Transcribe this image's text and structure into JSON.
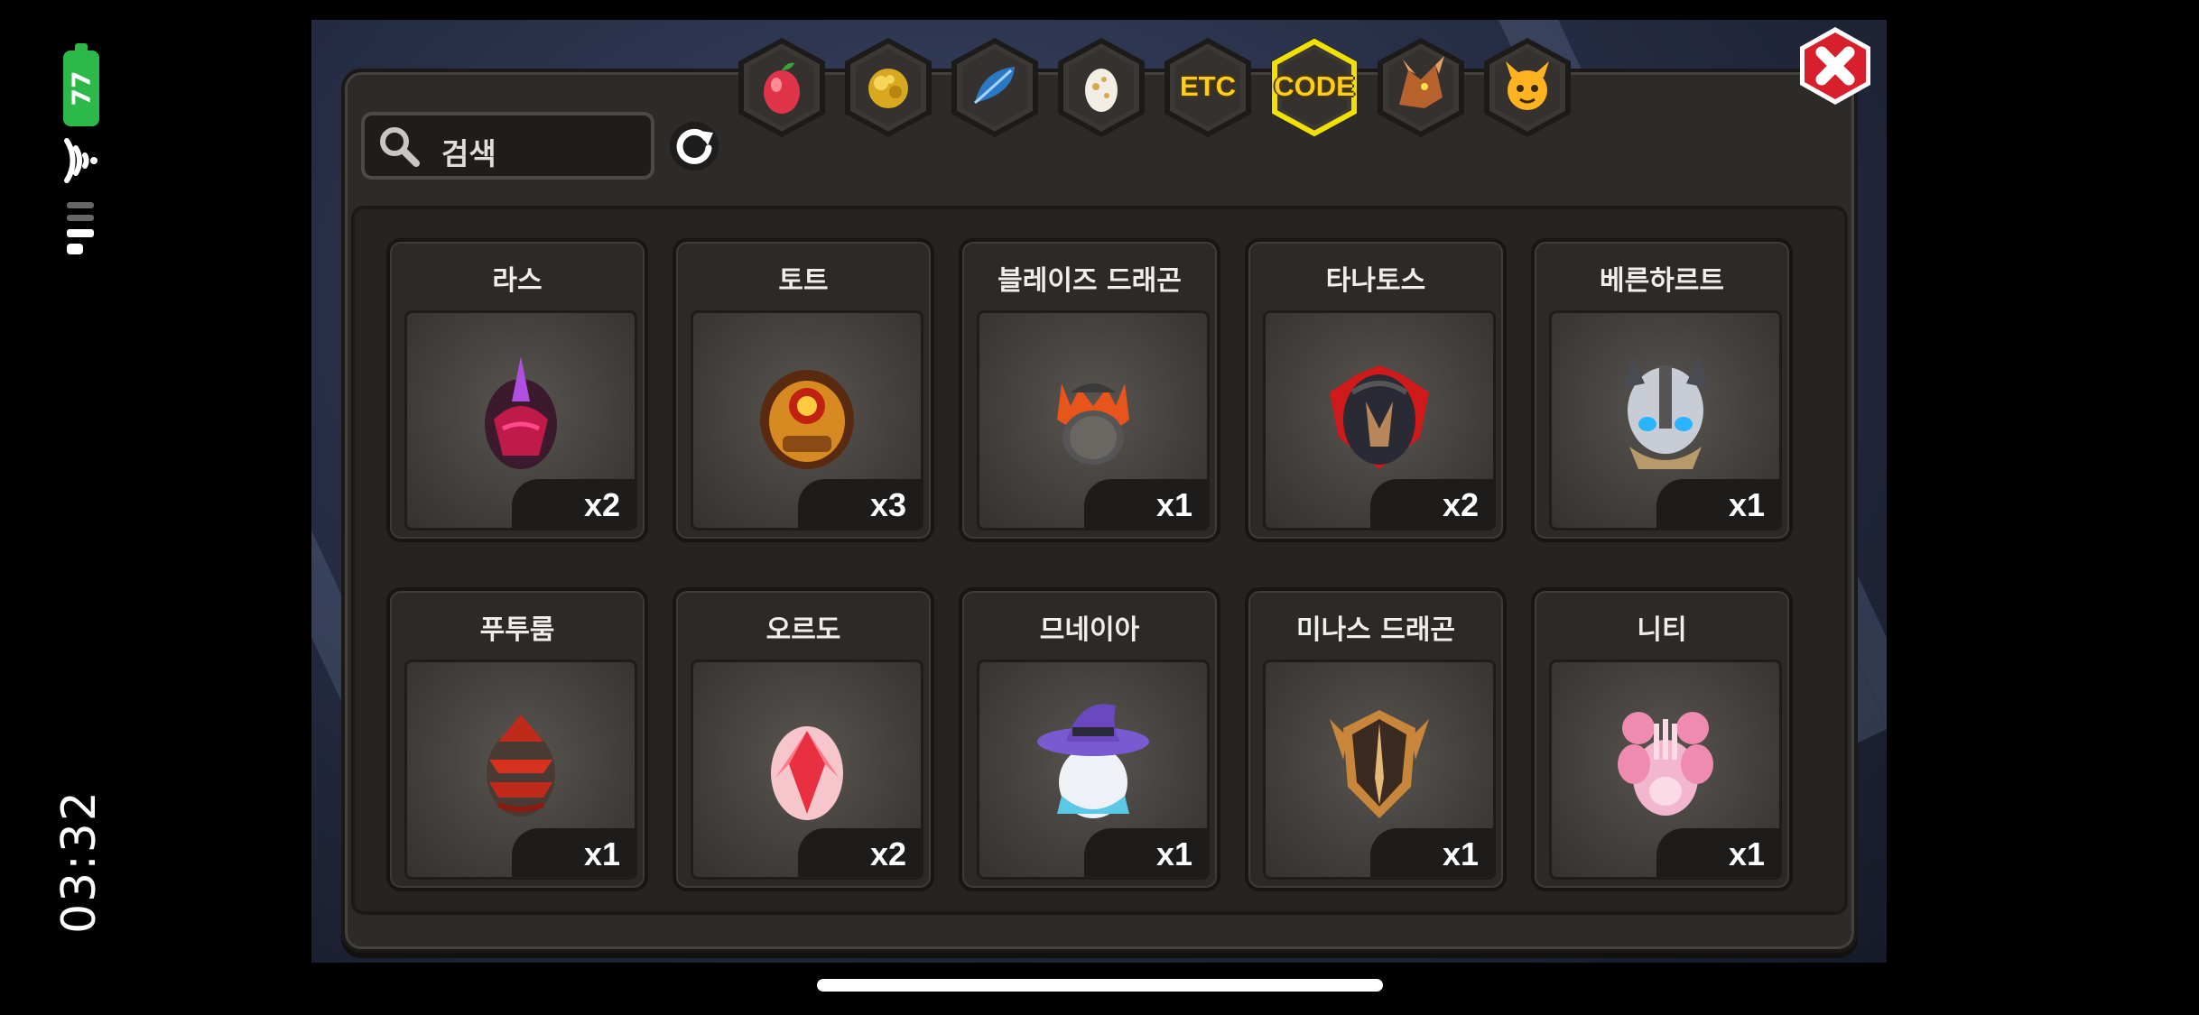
{
  "status": {
    "battery": "77",
    "time": "03:32",
    "colors": {
      "battery": "#2db84a"
    }
  },
  "search": {
    "label": "검색"
  },
  "tabs": [
    {
      "name": "fruit-tab",
      "icon": "red-fruit-icon",
      "text": ""
    },
    {
      "name": "gold-tab",
      "icon": "gold-nugget-icon",
      "text": ""
    },
    {
      "name": "feather-tab",
      "icon": "blue-feather-icon",
      "text": ""
    },
    {
      "name": "egg-tab",
      "icon": "egg-icon",
      "text": ""
    },
    {
      "name": "etc-tab",
      "icon": "",
      "text": "ETC"
    },
    {
      "name": "code-tab",
      "icon": "",
      "text": "CODE",
      "selected": true
    },
    {
      "name": "dragon-tab",
      "icon": "dragon-head-icon",
      "text": ""
    },
    {
      "name": "pet-tab",
      "icon": "horned-face-icon",
      "text": ""
    }
  ],
  "items": [
    {
      "title": "라스",
      "count": "x2",
      "icon": "ras-egg-icon"
    },
    {
      "title": "토트",
      "count": "x3",
      "icon": "tot-egg-icon"
    },
    {
      "title": "블레이즈 드래곤",
      "count": "x1",
      "icon": "blaze-dragon-egg-icon"
    },
    {
      "title": "타나토스",
      "count": "x2",
      "icon": "thanatos-egg-icon"
    },
    {
      "title": "베른하르트",
      "count": "x1",
      "icon": "bernhardt-egg-icon"
    },
    {
      "title": "푸투룸",
      "count": "x1",
      "icon": "futurum-egg-icon"
    },
    {
      "title": "오르도",
      "count": "x2",
      "icon": "ordo-egg-icon"
    },
    {
      "title": "므네이아",
      "count": "x1",
      "icon": "mneia-egg-icon"
    },
    {
      "title": "미나스 드래곤",
      "count": "x1",
      "icon": "minas-dragon-egg-icon"
    },
    {
      "title": "니티",
      "count": "x1",
      "icon": "niti-egg-icon"
    }
  ],
  "colors": {
    "selected_tab_ring": "#f2e000",
    "close_button": "#d8202c",
    "tab_text": "#ffcc22"
  }
}
